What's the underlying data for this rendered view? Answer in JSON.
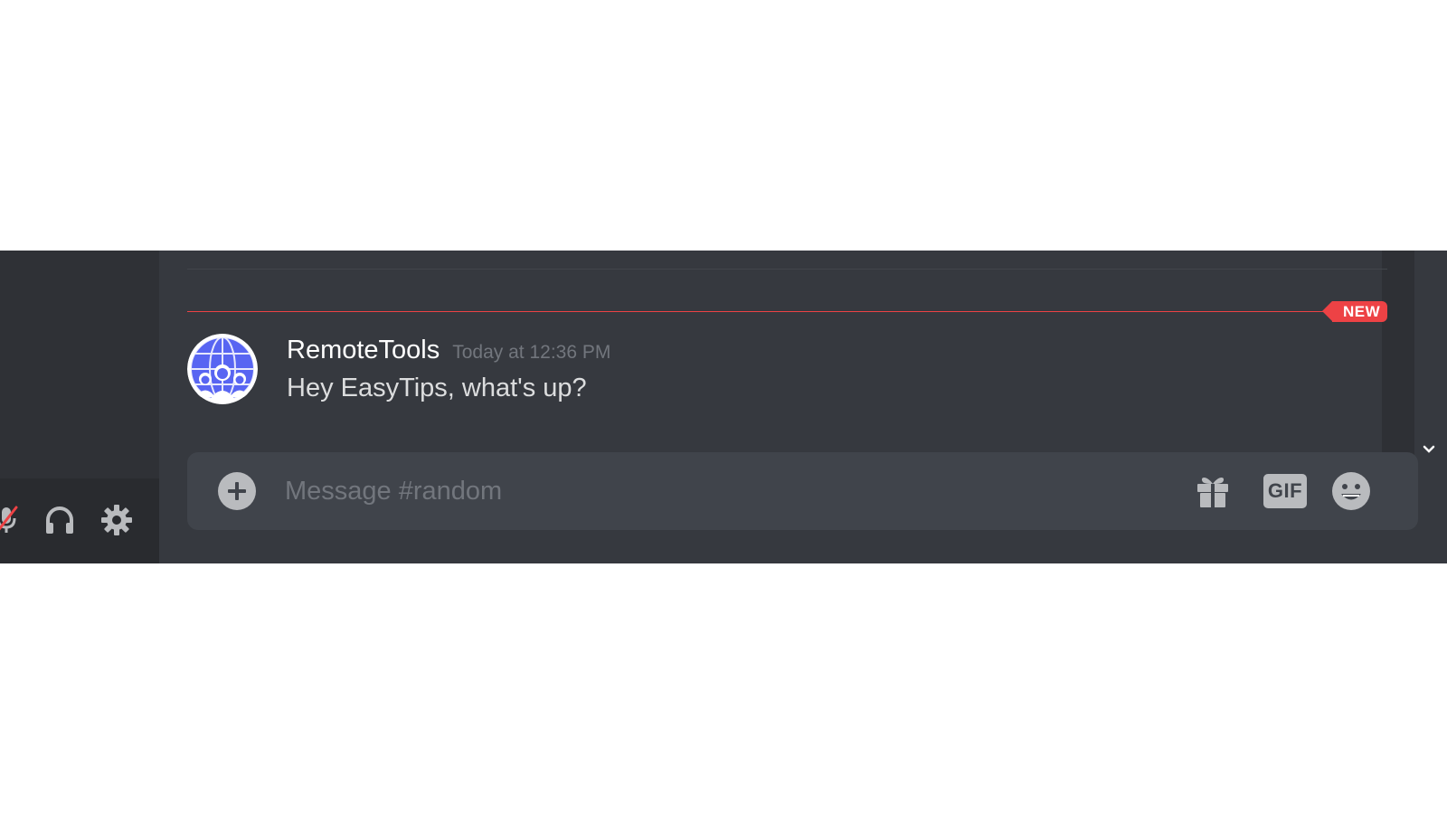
{
  "channel": {
    "name": "random"
  },
  "divider": {
    "new_label": "NEW"
  },
  "message": {
    "author": "RemoteTools",
    "timestamp": "Today at 12:36 PM",
    "text": "Hey EasyTips, what's up?",
    "avatar_icon": "group-globe-avatar"
  },
  "composer": {
    "placeholder": "Message #random",
    "value": "",
    "gif_label": "GIF"
  },
  "user_panel": {
    "icons": [
      "microphone-muted-icon",
      "headphones-icon",
      "gear-icon"
    ]
  },
  "colors": {
    "background": "#36393f",
    "sidebar": "#2f3136",
    "user_panel": "#292b2f",
    "composer": "#40444b",
    "new_red": "#ed4245",
    "avatar_blue": "#5865f2",
    "icon_gray": "#b9bbbe"
  }
}
